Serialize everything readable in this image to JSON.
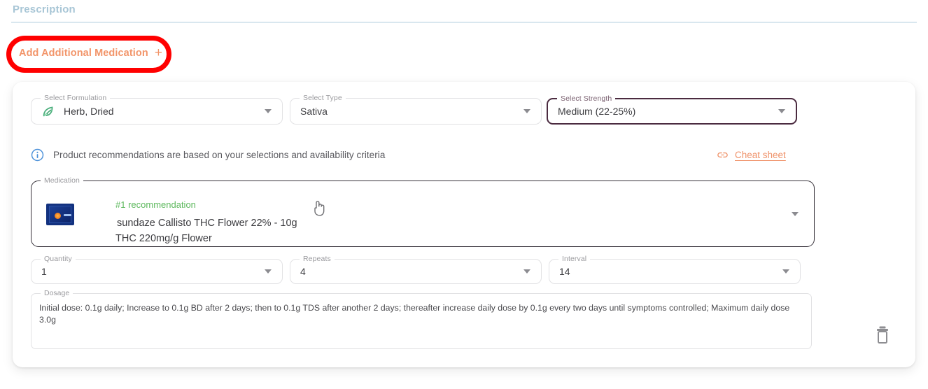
{
  "header": {
    "section_title": "Prescription"
  },
  "actions": {
    "add_medication_label": "Add Additional Medication",
    "add_medication_plus": "+"
  },
  "form": {
    "formulation": {
      "legend": "Select Formulation",
      "value": "Herb, Dried",
      "icon": "leaf-icon"
    },
    "type": {
      "legend": "Select Type",
      "value": "Sativa"
    },
    "strength": {
      "legend": "Select Strength",
      "value": "Medium (22-25%)",
      "focused": true
    },
    "quantity": {
      "legend": "Quantity",
      "value": "1"
    },
    "repeats": {
      "legend": "Repeats",
      "value": "4"
    },
    "interval": {
      "legend": "Interval",
      "value": "14"
    },
    "dosage": {
      "legend": "Dosage",
      "value": "Initial dose: 0.1g daily; Increase to 0.1g BD after 2 days; then to 0.1g TDS after another 2 days; thereafter increase daily dose by 0.1g every two days until symptoms controlled; Maximum daily dose 3.0g"
    }
  },
  "info": {
    "text": "Product recommendations are based on your selections and availability criteria",
    "icon": "info-icon"
  },
  "cheat_sheet": {
    "label": "Cheat sheet",
    "icon": "link-icon"
  },
  "medication": {
    "legend": "Medication",
    "recommendation_tag": "#1 recommendation",
    "name": "sundaze Callisto THC Flower 22% - 10g",
    "details": "THC 220mg/g Flower"
  },
  "delete": {
    "icon": "trash-icon"
  },
  "colors": {
    "accent_orange": "#f2956a",
    "section_title": "#a8c6d6",
    "recommendation_green": "#5cb85c",
    "focus_border": "#4b2b40",
    "annotation_red": "#ff0000",
    "info_blue": "#4a90d9"
  }
}
